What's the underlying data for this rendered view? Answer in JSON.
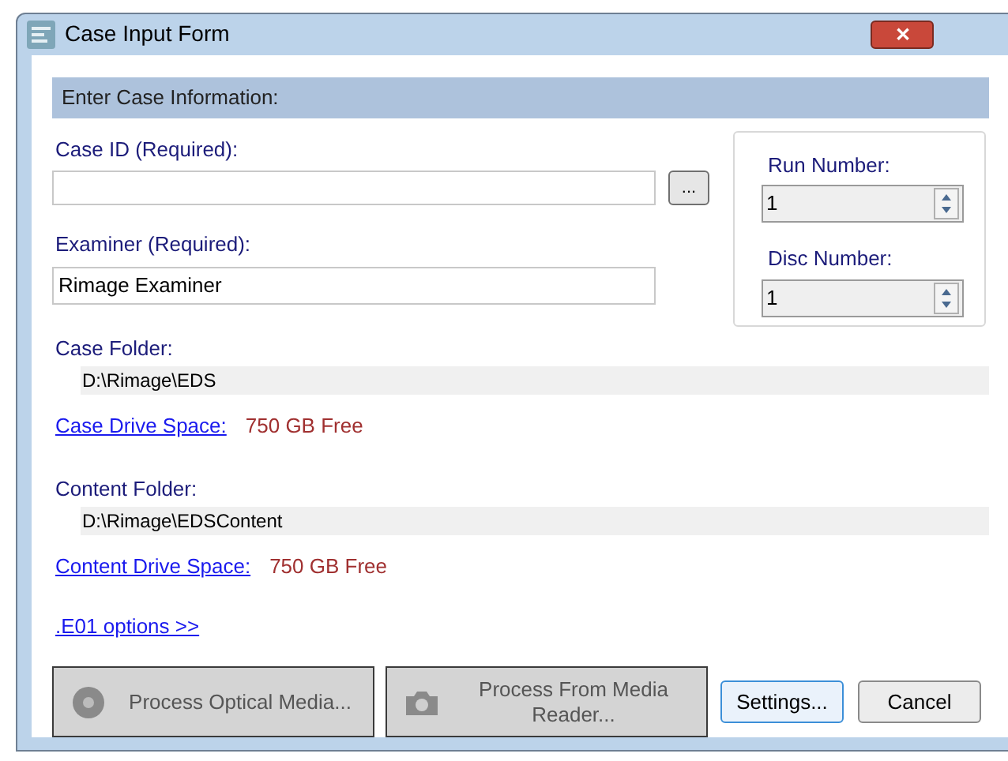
{
  "window": {
    "title": "Case Input Form",
    "close_label": "✕"
  },
  "header": "Enter Case Information:",
  "case_id": {
    "label": "Case ID (Required):",
    "browse_label": "..."
  },
  "examiner": {
    "label": "Examiner (Required):",
    "value": "Rimage Examiner"
  },
  "run_number": {
    "label": "Run Number:",
    "value": "1"
  },
  "disc_number": {
    "label": "Disc Number:",
    "value": "1"
  },
  "case_folder": {
    "label": "Case Folder:",
    "path": "D:\\Rimage\\EDS",
    "space_link": "Case Drive Space:",
    "space_value": "750 GB Free"
  },
  "content_folder": {
    "label": "Content Folder:",
    "path": "D:\\Rimage\\EDSContent",
    "space_link": "Content Drive Space:",
    "space_value": "750 GB Free"
  },
  "options_link": ".E01 options >>",
  "buttons": [
    {
      "kind": "disc",
      "label": "Process Optical Media...",
      "disabled": true
    },
    {
      "kind": "camera",
      "label": "Process From Media Reader...",
      "disabled": true
    },
    {
      "kind": "plain",
      "label": "Settings...",
      "disabled": false,
      "focused": true
    },
    {
      "kind": "plain",
      "label": "Cancel",
      "disabled": false,
      "focused": false
    }
  ]
}
